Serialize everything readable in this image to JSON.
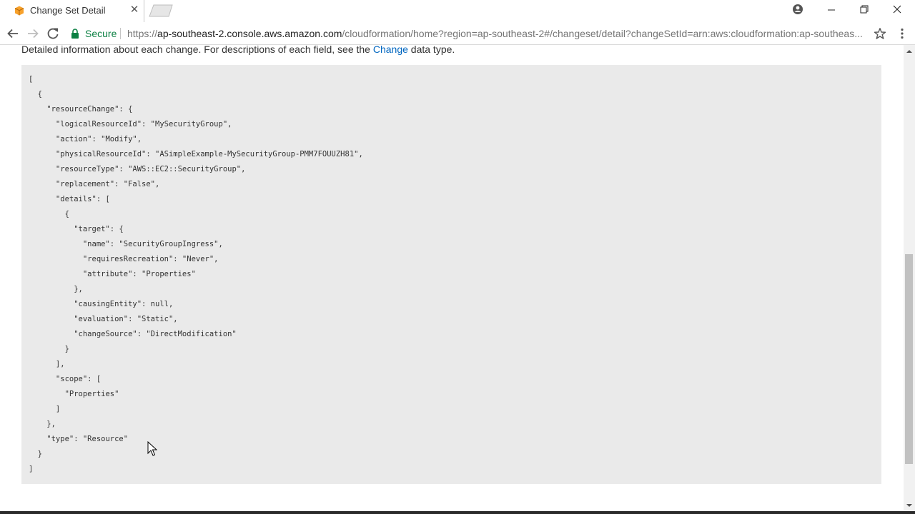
{
  "browser": {
    "tab": {
      "title": "Change Set Detail",
      "close_glyph": "✕",
      "favicon": "aws-cube-icon"
    },
    "omnibox": {
      "secure_label": "Secure",
      "url_scheme": "https://",
      "url_host": "ap-southeast-2.console.aws.amazon.com",
      "url_path": "/cloudformation/home?region=ap-southeast-2#/changeset/detail?changeSetId=arn:aws:cloudformation:ap-southeas..."
    },
    "colors": {
      "secure_green": "#0b8043",
      "link_blue": "#0066c0",
      "code_background": "#eaeaea",
      "favicon_orange": "#f7a12b"
    }
  },
  "page": {
    "intro": {
      "before_link": "Detailed information about each change. For descriptions of each field, see the ",
      "link_text": "Change",
      "after_link": " data type."
    },
    "code_lines": [
      "[",
      "  {",
      "    \"resourceChange\": {",
      "      \"logicalResourceId\": \"MySecurityGroup\",",
      "      \"action\": \"Modify\",",
      "      \"physicalResourceId\": \"ASimpleExample-MySecurityGroup-PMM7FOUUZH81\",",
      "      \"resourceType\": \"AWS::EC2::SecurityGroup\",",
      "      \"replacement\": \"False\",",
      "      \"details\": [",
      "        {",
      "          \"target\": {",
      "            \"name\": \"SecurityGroupIngress\",",
      "            \"requiresRecreation\": \"Never\",",
      "            \"attribute\": \"Properties\"",
      "          },",
      "          \"causingEntity\": null,",
      "          \"evaluation\": \"Static\",",
      "          \"changeSource\": \"DirectModification\"",
      "        }",
      "      ],",
      "      \"scope\": [",
      "        \"Properties\"",
      "      ]",
      "    },",
      "    \"type\": \"Resource\"",
      "  }",
      "]"
    ]
  }
}
